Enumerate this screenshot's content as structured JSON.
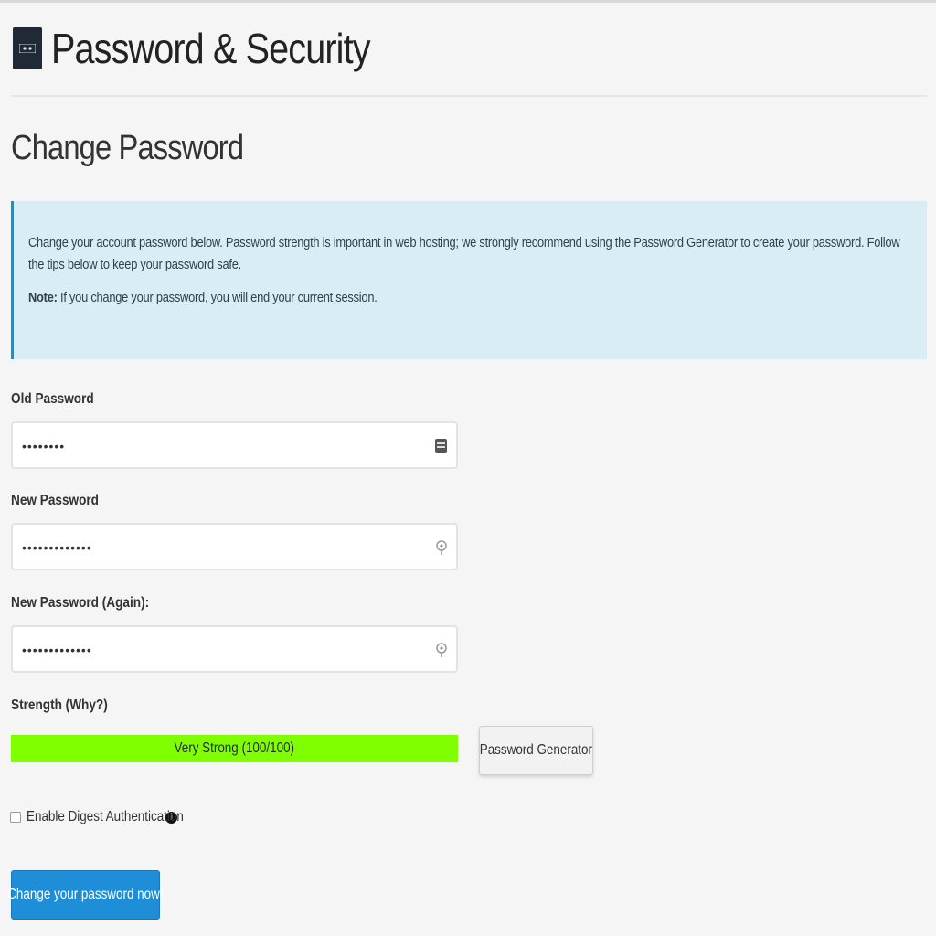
{
  "header": {
    "title": "Password & Security",
    "icon": "password-security-icon"
  },
  "section": {
    "title": "Change Password"
  },
  "info": {
    "text": "Change your account password below. Password strength is important in web hosting; we strongly recommend using the Password Generator to create your password. Follow the tips below to keep your password safe.",
    "note_label": "Note:",
    "note_text": " If you change your password, you will end your current session."
  },
  "form": {
    "old_password": {
      "label": "Old Password",
      "value": "••••••••"
    },
    "new_password": {
      "label": "New Password",
      "value": "•••••••••••••"
    },
    "new_password_again": {
      "label": "New Password (Again):",
      "value": "•••••••••••••"
    },
    "strength": {
      "label": "Strength (Why?)",
      "text": "Very Strong (100/100)",
      "percent": 100,
      "color": "#7fff00"
    },
    "generator_button": "Password Generator",
    "digest": {
      "label": "Enable Digest Authentication",
      "checked": false,
      "info_glyph": "i"
    },
    "submit_button": "Change your password now!"
  },
  "colors": {
    "accent": "#1f8ed9",
    "info_bg": "#d9edf7",
    "info_border": "#3a87ad"
  }
}
